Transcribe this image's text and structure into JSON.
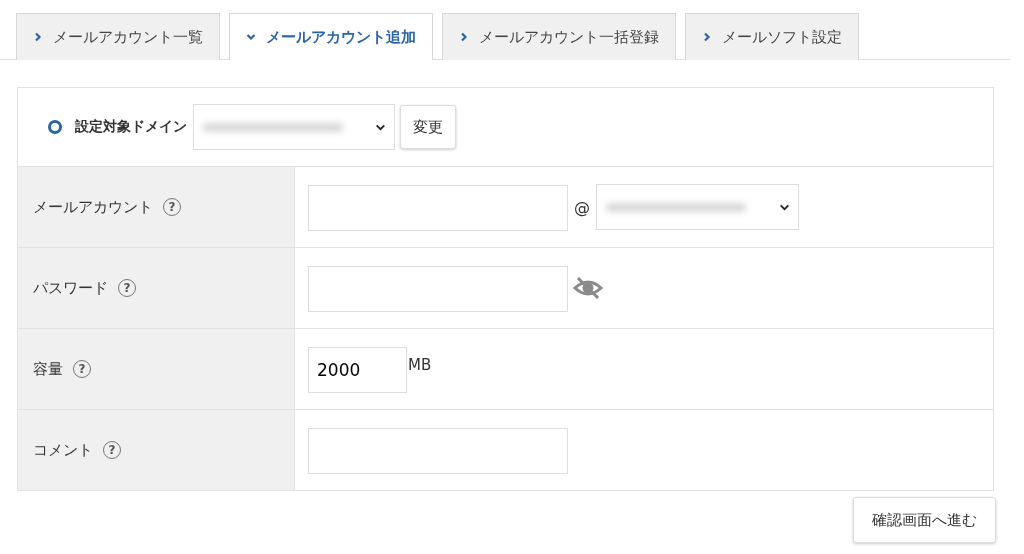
{
  "tabs": [
    {
      "label": "メールアカウント一覧",
      "selected": false
    },
    {
      "label": "メールアカウント追加",
      "selected": true
    },
    {
      "label": "メールアカウント一括登録",
      "selected": false
    },
    {
      "label": "メールソフト設定",
      "selected": false
    }
  ],
  "domain": {
    "label": "設定対象ドメイン",
    "button": "変更"
  },
  "rows": [
    {
      "kind": "account",
      "label": "メールアカウント",
      "help": "?",
      "at": "@"
    },
    {
      "kind": "password",
      "label": "パスワード",
      "help": "?"
    },
    {
      "kind": "quota",
      "label": "容量",
      "help": "?",
      "value": "2000",
      "unit": "MB"
    },
    {
      "kind": "text",
      "label": "コメント",
      "help": "?"
    }
  ],
  "submit": "確認画面へ進む"
}
